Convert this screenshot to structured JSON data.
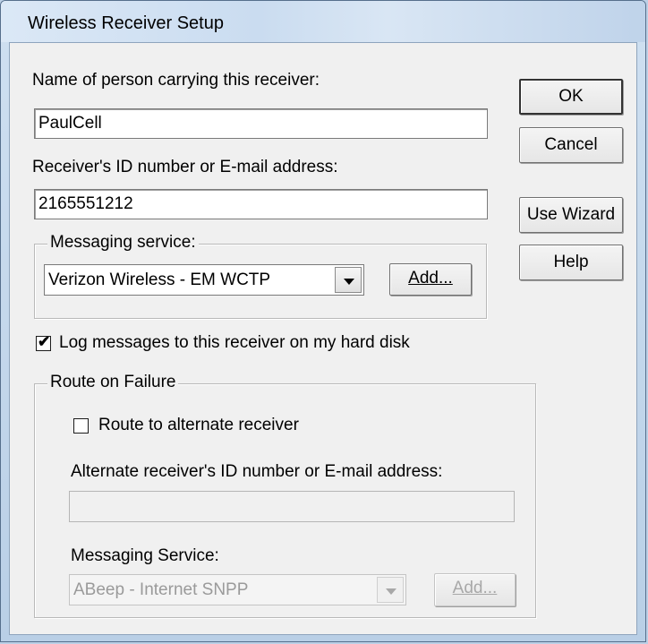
{
  "window": {
    "title": "Wireless Receiver Setup"
  },
  "main": {
    "name_label": "Name of person carrying this receiver:",
    "name_value": "PaulCell",
    "id_label": "Receiver's ID number or E-mail address:",
    "id_value": "2165551212",
    "messaging_group_caption": "Messaging service:",
    "messaging_selected": "Verizon Wireless - EM WCTP",
    "messaging_add": "Add...",
    "log_checkbox_label": "Log messages to this receiver on my hard disk",
    "log_checked": true
  },
  "buttons": {
    "ok": "OK",
    "cancel": "Cancel",
    "wizard": "Use Wizard",
    "help": "Help"
  },
  "route": {
    "group_caption": "Route on Failure",
    "alt_checkbox_label": "Route to alternate receiver",
    "alt_checked": false,
    "alt_id_label": "Alternate receiver's ID number or E-mail address:",
    "alt_id_value": "",
    "service_label": "Messaging Service:",
    "service_selected": "ABeep - Internet SNPP",
    "service_add": "Add..."
  },
  "colors": {
    "background": "#f0f0f0",
    "titlebar": "#cadcf0",
    "disabled_text": "#a8a8a8"
  },
  "icons": {
    "checkbox_check": "check-icon",
    "dropdown": "chevron-down-icon"
  }
}
